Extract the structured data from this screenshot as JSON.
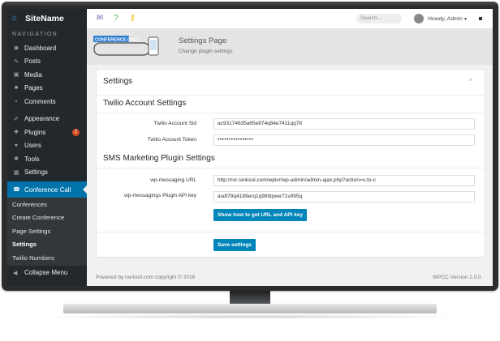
{
  "app": {
    "name": "SiteName",
    "brand_icon": "home-icon",
    "accent": "#0073aa"
  },
  "sidebar": {
    "nav_heading": "NAVIGATION",
    "items": [
      {
        "label": "Dashboard",
        "icon": "dashboard-icon"
      },
      {
        "label": "Posts",
        "icon": "pin-icon"
      },
      {
        "label": "Media",
        "icon": "media-icon"
      },
      {
        "label": "Pages",
        "icon": "page-icon"
      },
      {
        "label": "Comments",
        "icon": "comment-icon"
      },
      {
        "label": "Appearance",
        "icon": "brush-icon"
      },
      {
        "label": "Plugins",
        "icon": "plugin-icon",
        "badge": "1"
      },
      {
        "label": "Users",
        "icon": "users-icon"
      },
      {
        "label": "Tools",
        "icon": "wrench-icon"
      },
      {
        "label": "Settings",
        "icon": "settings-icon"
      }
    ],
    "active": {
      "label": "Conference Call",
      "icon": "phone-icon"
    },
    "submenu": [
      "Conferences",
      "Create Conference",
      "Page Settings",
      "Settings",
      "Twilio Numbers"
    ],
    "submenu_current": "Settings",
    "collapse_label": "Collapse Menu"
  },
  "topbar": {
    "icons": [
      "question-comment-icon",
      "question-icon",
      "key-icon"
    ],
    "search_placeholder": "Search...",
    "user": "Howdy, Admin"
  },
  "page": {
    "logo_text": "CONFERENCE CALL",
    "title": "Settings Page",
    "subtitle": "Change plugin settings."
  },
  "panel": {
    "title": "Settings",
    "twilio_heading": "Twilio Account Settings",
    "sid_label": "Twilio Account Sid",
    "sid_value": "ac93174635a65e874q84e7411qq78",
    "token_label": "Twilio Account Token",
    "token_value": "••••••••••••••••",
    "sms_heading": "SMS Marketing Plugin Settings",
    "url_label": "wp-messaging URL",
    "url_value": "http://ror.ranksol.com/wpivr/wp-admin/admin-ajax.php?action=s-to-c",
    "key_label": "wp-messagings Plugin API key",
    "key_value": "asdf78q4189erq1q989qwer71v995q",
    "help_button": "Show how to get URL and API key",
    "save_button": "Save settings"
  },
  "footer": {
    "left": "Powered by ranksol.com copyright © 2016",
    "right": "WPCC Version 1.0.0"
  }
}
